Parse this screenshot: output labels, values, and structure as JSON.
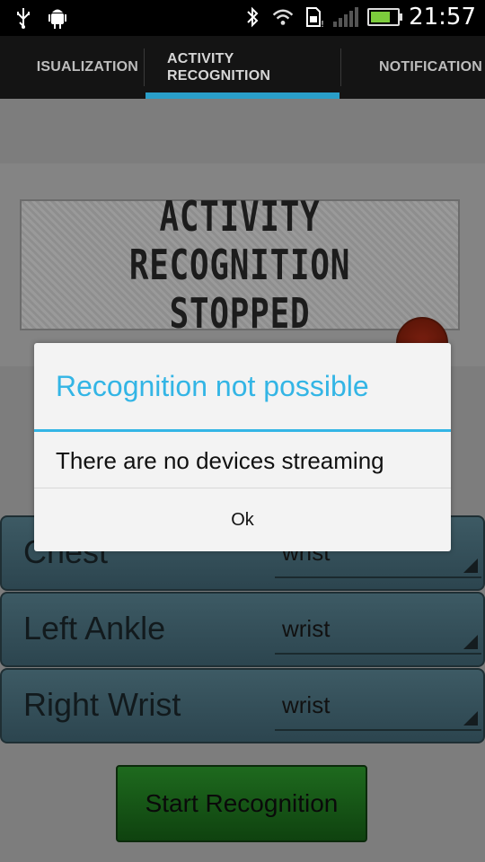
{
  "status_bar": {
    "time": "21:57",
    "icons_left": [
      "usb-icon",
      "android-debug-icon"
    ],
    "icons_right": [
      "bluetooth-icon",
      "wifi-icon",
      "sd-card-icon",
      "signal-icon",
      "battery-icon"
    ],
    "battery_level": 0.75
  },
  "tabs": [
    {
      "label": "VISUALIZATION",
      "visible_label": "ISUALIZATION",
      "selected": false
    },
    {
      "label": "ACTIVITY RECOGNITION",
      "selected": true
    },
    {
      "label": "NOTIFICATION",
      "visible_label": "NOTIFICATION",
      "selected": false
    }
  ],
  "status_stamp": {
    "line1": "ACTIVITY RECOGNITION",
    "line2": "STOPPED"
  },
  "sensors": [
    {
      "label": "Chest",
      "placement": "wrist"
    },
    {
      "label": "Left Ankle",
      "placement": "wrist"
    },
    {
      "label": "Right Wrist",
      "placement": "wrist"
    }
  ],
  "start_button": {
    "label": "Start Recognition"
  },
  "dialog": {
    "title": "Recognition not possible",
    "message": "There are no devices streaming",
    "ok_label": "Ok"
  },
  "colors": {
    "accent": "#33b5e5",
    "tab_indicator": "#2a9ec8",
    "start_button": "#1e6a1e",
    "sensor_row": "#3d5a64"
  }
}
